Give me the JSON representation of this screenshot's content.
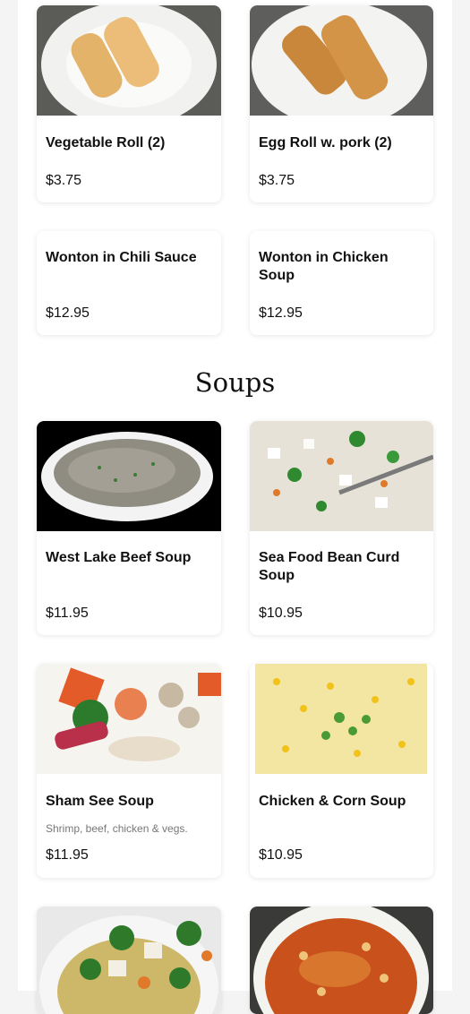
{
  "appetizers": [
    {
      "name": "Vegetable Roll (2)",
      "price": "$3.75"
    },
    {
      "name": "Egg Roll w. pork (2)",
      "price": "$3.75"
    },
    {
      "name": "Wonton in Chili Sauce",
      "price": "$12.95"
    },
    {
      "name": "Wonton in Chicken Soup",
      "price": "$12.95"
    }
  ],
  "soups": {
    "title": "Soups",
    "items": [
      {
        "name": "West Lake Beef Soup",
        "price": "$11.95"
      },
      {
        "name": "Sea Food Bean Curd Soup",
        "price": "$10.95"
      },
      {
        "name": "Sham See Soup",
        "description": "Shrimp, beef, chicken & vegs.",
        "price": "$11.95"
      },
      {
        "name": "Chicken & Corn Soup",
        "price": "$10.95"
      }
    ]
  },
  "icons": {
    "vegetable_roll": "vegetable-roll-photo",
    "egg_roll": "egg-roll-photo",
    "west_lake": "west-lake-beef-soup-photo",
    "seafood_bean_curd": "sea-food-bean-curd-soup-photo",
    "sham_see": "sham-see-soup-photo",
    "chicken_corn": "chicken-corn-soup-photo",
    "veg_soup": "vegetable-soup-photo",
    "hot_sour": "hot-sour-soup-photo"
  }
}
